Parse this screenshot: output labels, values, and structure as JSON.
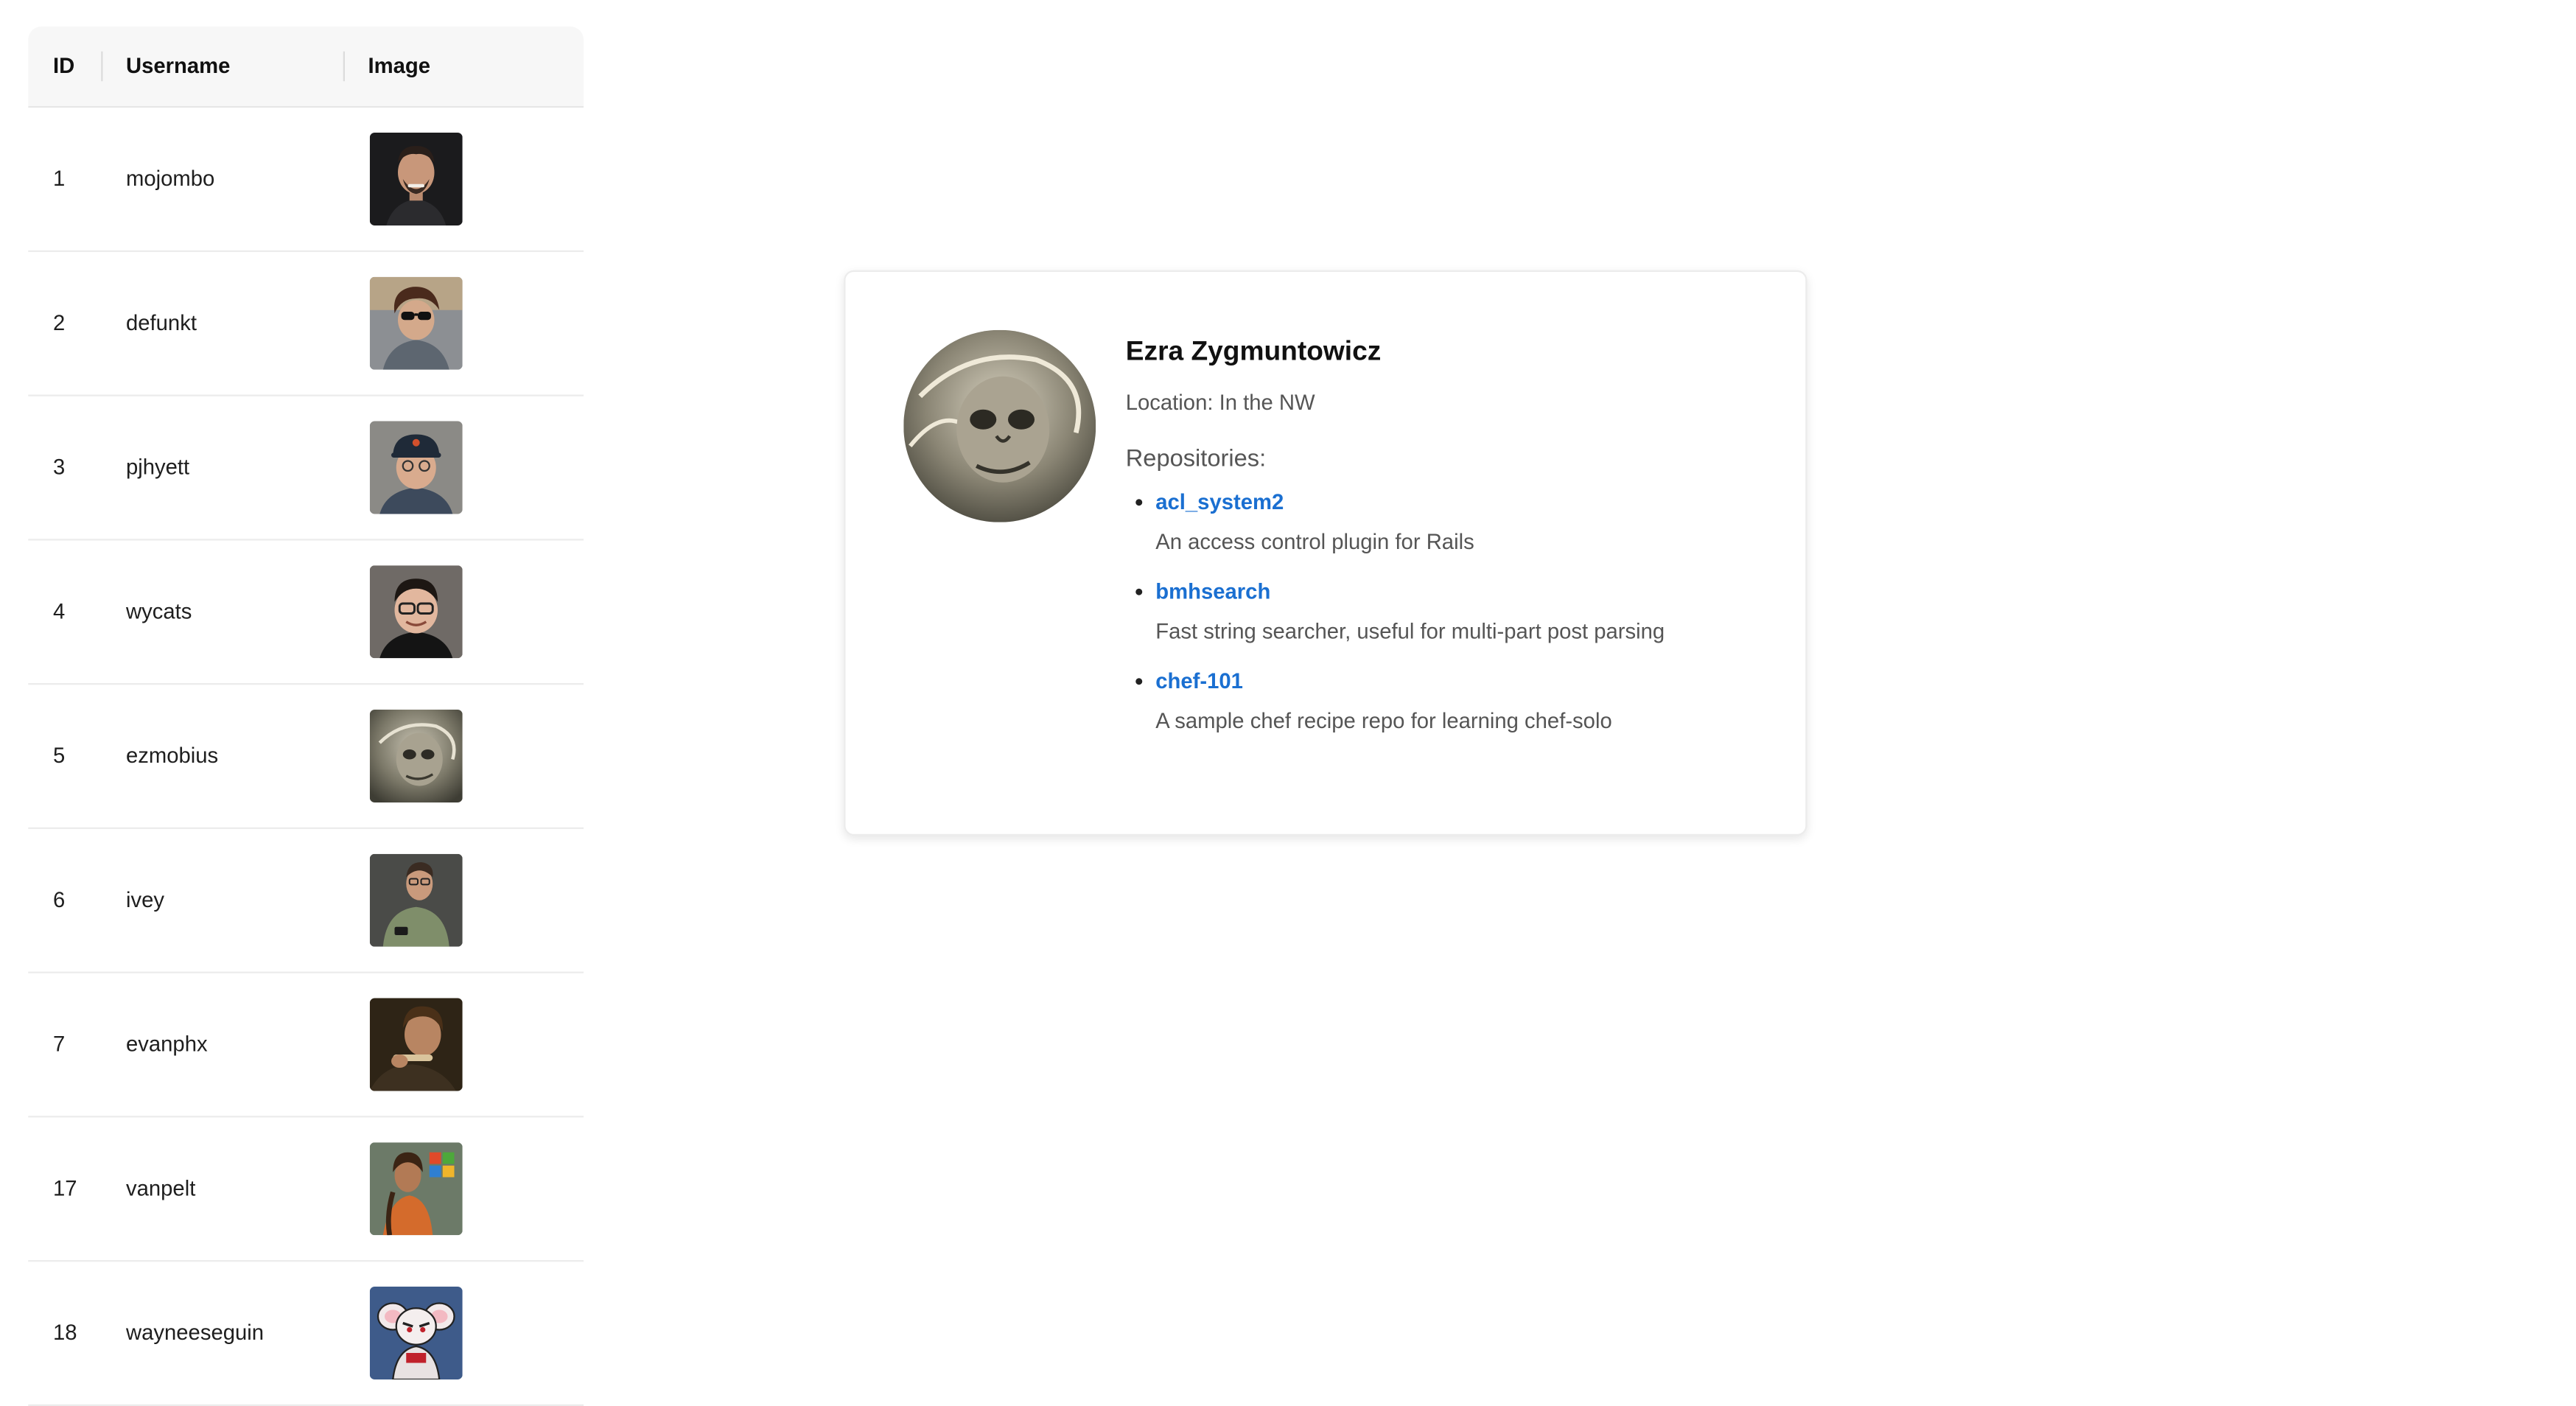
{
  "table": {
    "headers": {
      "id": "ID",
      "username": "Username",
      "image": "Image"
    },
    "rows": [
      {
        "id": "1",
        "username": "mojombo",
        "avatar_icon": "user-avatar-photo"
      },
      {
        "id": "2",
        "username": "defunkt",
        "avatar_icon": "user-avatar-photo"
      },
      {
        "id": "3",
        "username": "pjhyett",
        "avatar_icon": "user-avatar-photo"
      },
      {
        "id": "4",
        "username": "wycats",
        "avatar_icon": "user-avatar-photo"
      },
      {
        "id": "5",
        "username": "ezmobius",
        "avatar_icon": "user-avatar-illustration"
      },
      {
        "id": "6",
        "username": "ivey",
        "avatar_icon": "user-avatar-photo"
      },
      {
        "id": "7",
        "username": "evanphx",
        "avatar_icon": "user-avatar-photo"
      },
      {
        "id": "17",
        "username": "vanpelt",
        "avatar_icon": "user-avatar-photo"
      },
      {
        "id": "18",
        "username": "wayneeseguin",
        "avatar_icon": "user-avatar-cartoon"
      }
    ]
  },
  "profile": {
    "name": "Ezra Zygmuntowicz",
    "location": "Location: In the NW",
    "repos_heading": "Repositories:",
    "repositories": [
      {
        "name": "acl_system2",
        "description": "An access control plugin for Rails"
      },
      {
        "name": "bmhsearch",
        "description": "Fast string searcher, useful for multi-part post parsing"
      },
      {
        "name": "chef-101",
        "description": "A sample chef recipe repo for learning chef-solo"
      }
    ]
  },
  "colors": {
    "link": "#1a6fd1",
    "header_bg": "#f7f7f7",
    "border": "#ececec",
    "muted_text": "#555555"
  }
}
